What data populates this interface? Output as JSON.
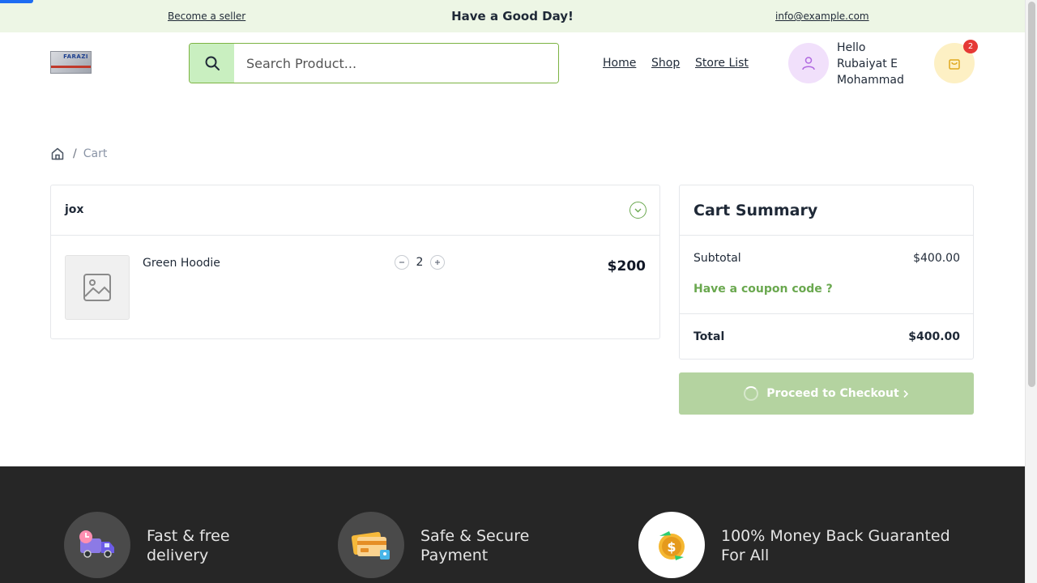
{
  "topbar": {
    "become_seller": "Become a seller",
    "greeting": "Have a Good Day!",
    "email": "info@example.com"
  },
  "header": {
    "logo_text": "FARAZI",
    "search_placeholder": "Search Product...",
    "nav": {
      "home": "Home",
      "shop": "Shop",
      "store_list": "Store List"
    },
    "user": {
      "hello": "Hello",
      "name": "Rubaiyat E Mohammad"
    },
    "cart_count": "2"
  },
  "breadcrumb": {
    "current": "Cart"
  },
  "cart": {
    "store_name": "jox",
    "items": [
      {
        "name": "Green Hoodie",
        "quantity": "2",
        "price": "$200"
      }
    ]
  },
  "summary": {
    "title": "Cart Summary",
    "subtotal_label": "Subtotal",
    "subtotal_value": "$400.00",
    "coupon_label": "Have a coupon code ?",
    "total_label": "Total",
    "total_value": "$400.00",
    "checkout_label": "Proceed to Checkout"
  },
  "footer": {
    "features": [
      {
        "line1": "Fast & free",
        "line2": "delivery",
        "icon": "delivery-truck-icon"
      },
      {
        "line1": "Safe & Secure",
        "line2": "Payment",
        "icon": "secure-card-icon"
      },
      {
        "line1": "100% Money Back Guaranted",
        "line2": "For All",
        "icon": "money-back-coin-icon"
      }
    ]
  },
  "colors": {
    "brand_green": "#6aa84f",
    "search_button_bg": "#c9efc0",
    "topbar_bg": "#edf6e5",
    "checkout_bg": "#b4d3a0",
    "badge_red": "#e53935",
    "footer_bg": "#262626"
  }
}
